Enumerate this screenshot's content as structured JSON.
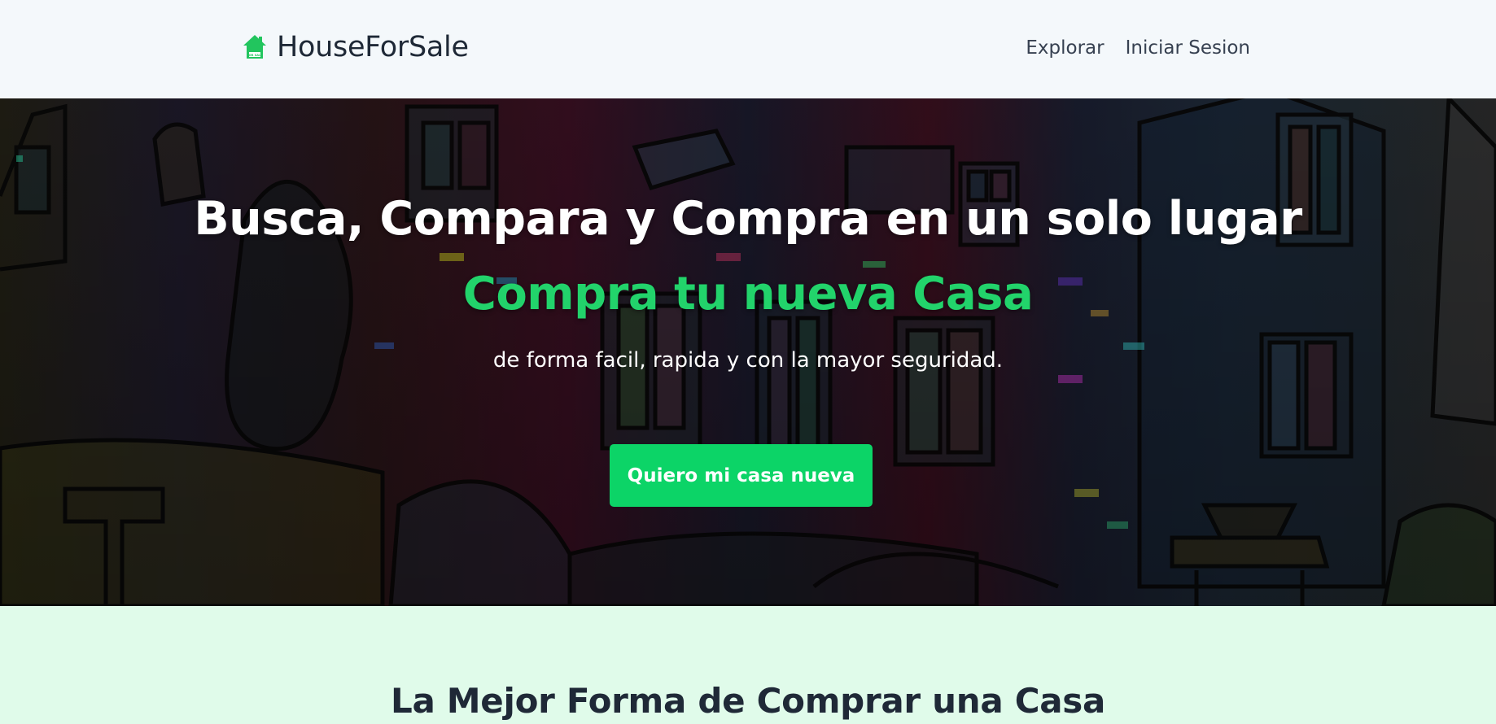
{
  "navbar": {
    "brand_name": "HouseForSale",
    "brand_icon": "house-icon",
    "brand_icon_subtext": "FOR SALE",
    "links": [
      {
        "label": "Explorar"
      },
      {
        "label": "Iniciar Sesion"
      }
    ]
  },
  "hero": {
    "title": "Busca, Compara y Compra en un solo lugar",
    "subtitle": "Compra tu nueva Casa",
    "text": "de forma facil, rapida y con la mayor seguridad.",
    "cta_label": "Quiero mi casa nueva"
  },
  "section": {
    "title": "La Mejor Forma de Comprar una Casa"
  },
  "colors": {
    "brand_green": "#22c55e",
    "cta_green": "#0cd467",
    "subtitle_green": "#22d36b",
    "navbar_bg": "#f4f8fb",
    "section_bg": "#e0fbea",
    "text_dark": "#1f2937"
  }
}
